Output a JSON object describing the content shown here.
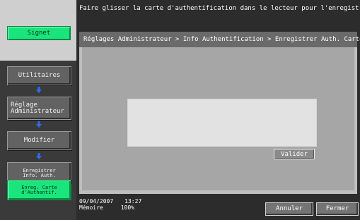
{
  "top_message": "Faire glisser la carte d'authentification dans le lecteur pour l'enregistrer.",
  "sidebar": {
    "bookmark_label": "Signet",
    "items": [
      {
        "lines": [
          "Utilitaires"
        ]
      },
      {
        "lines": [
          "Réglage",
          "Administrateur"
        ]
      },
      {
        "lines": [
          "Modifier"
        ]
      },
      {
        "lines": [
          "Enregistrer",
          "Info. Auth."
        ]
      },
      {
        "lines": [
          "Enreg. Carte",
          "d'Authentif."
        ]
      }
    ]
  },
  "breadcrumb": "Réglages Administrateur > Info Authentification > Enregistrer Auth. Carte",
  "validate_label": "Valider",
  "status": {
    "date": "09/04/2007",
    "time": "13:27",
    "memory_label": "Mémoire",
    "memory_value": "100%"
  },
  "buttons": {
    "cancel": "Annuler",
    "close": "Fermer"
  },
  "colors": {
    "accent": "#19e57c",
    "background": "#2c2c2c",
    "panel": "#bfbfbf"
  }
}
